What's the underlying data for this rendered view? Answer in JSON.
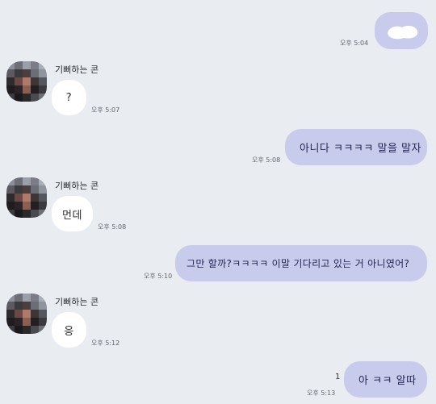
{
  "contact": {
    "name": "기뻐하는 콘"
  },
  "messages": [
    {
      "side": "mine",
      "text": "",
      "time": "오후 5:04",
      "redacted": true
    },
    {
      "side": "theirs",
      "text": "?",
      "time": "오후 5:07"
    },
    {
      "side": "mine",
      "text": "아니다 ㅋㅋㅋㅋ 말을 말자",
      "time": "오후 5:08"
    },
    {
      "side": "theirs",
      "text": "먼데",
      "time": "오후 5:08"
    },
    {
      "side": "mine",
      "text": "그만 할까?ㅋㅋㅋㅋ 이말 기다리고 있는 거 아니였어?",
      "time": "오후 5:10"
    },
    {
      "side": "theirs",
      "text": "응",
      "time": "오후 5:12"
    },
    {
      "side": "mine",
      "text": "아 ㅋㅋ 알따",
      "time": "오후 5:13",
      "unread": "1"
    }
  ],
  "colors": {
    "background": "#e9ecf1",
    "my_bubble": "#c8cbec",
    "their_bubble": "#ffffff"
  },
  "avatar_pixels": [
    [
      "#8a8f99",
      "#6d6f78",
      "#9aa0aa",
      "#7a7d86",
      "#a8aeb8"
    ],
    [
      "#5b5a60",
      "#3c3a3d",
      "#4a3f3e",
      "#6a6e77",
      "#8f949d"
    ],
    [
      "#2e2b2e",
      "#6b4a45",
      "#b07a6a",
      "#3d3536",
      "#55575e"
    ],
    [
      "#1e1c1f",
      "#2a2426",
      "#8c5f55",
      "#221f22",
      "#3a3a40"
    ],
    [
      "#3b3a40",
      "#1b191c",
      "#2b2829",
      "#4b4a50",
      "#6c6e75"
    ]
  ]
}
